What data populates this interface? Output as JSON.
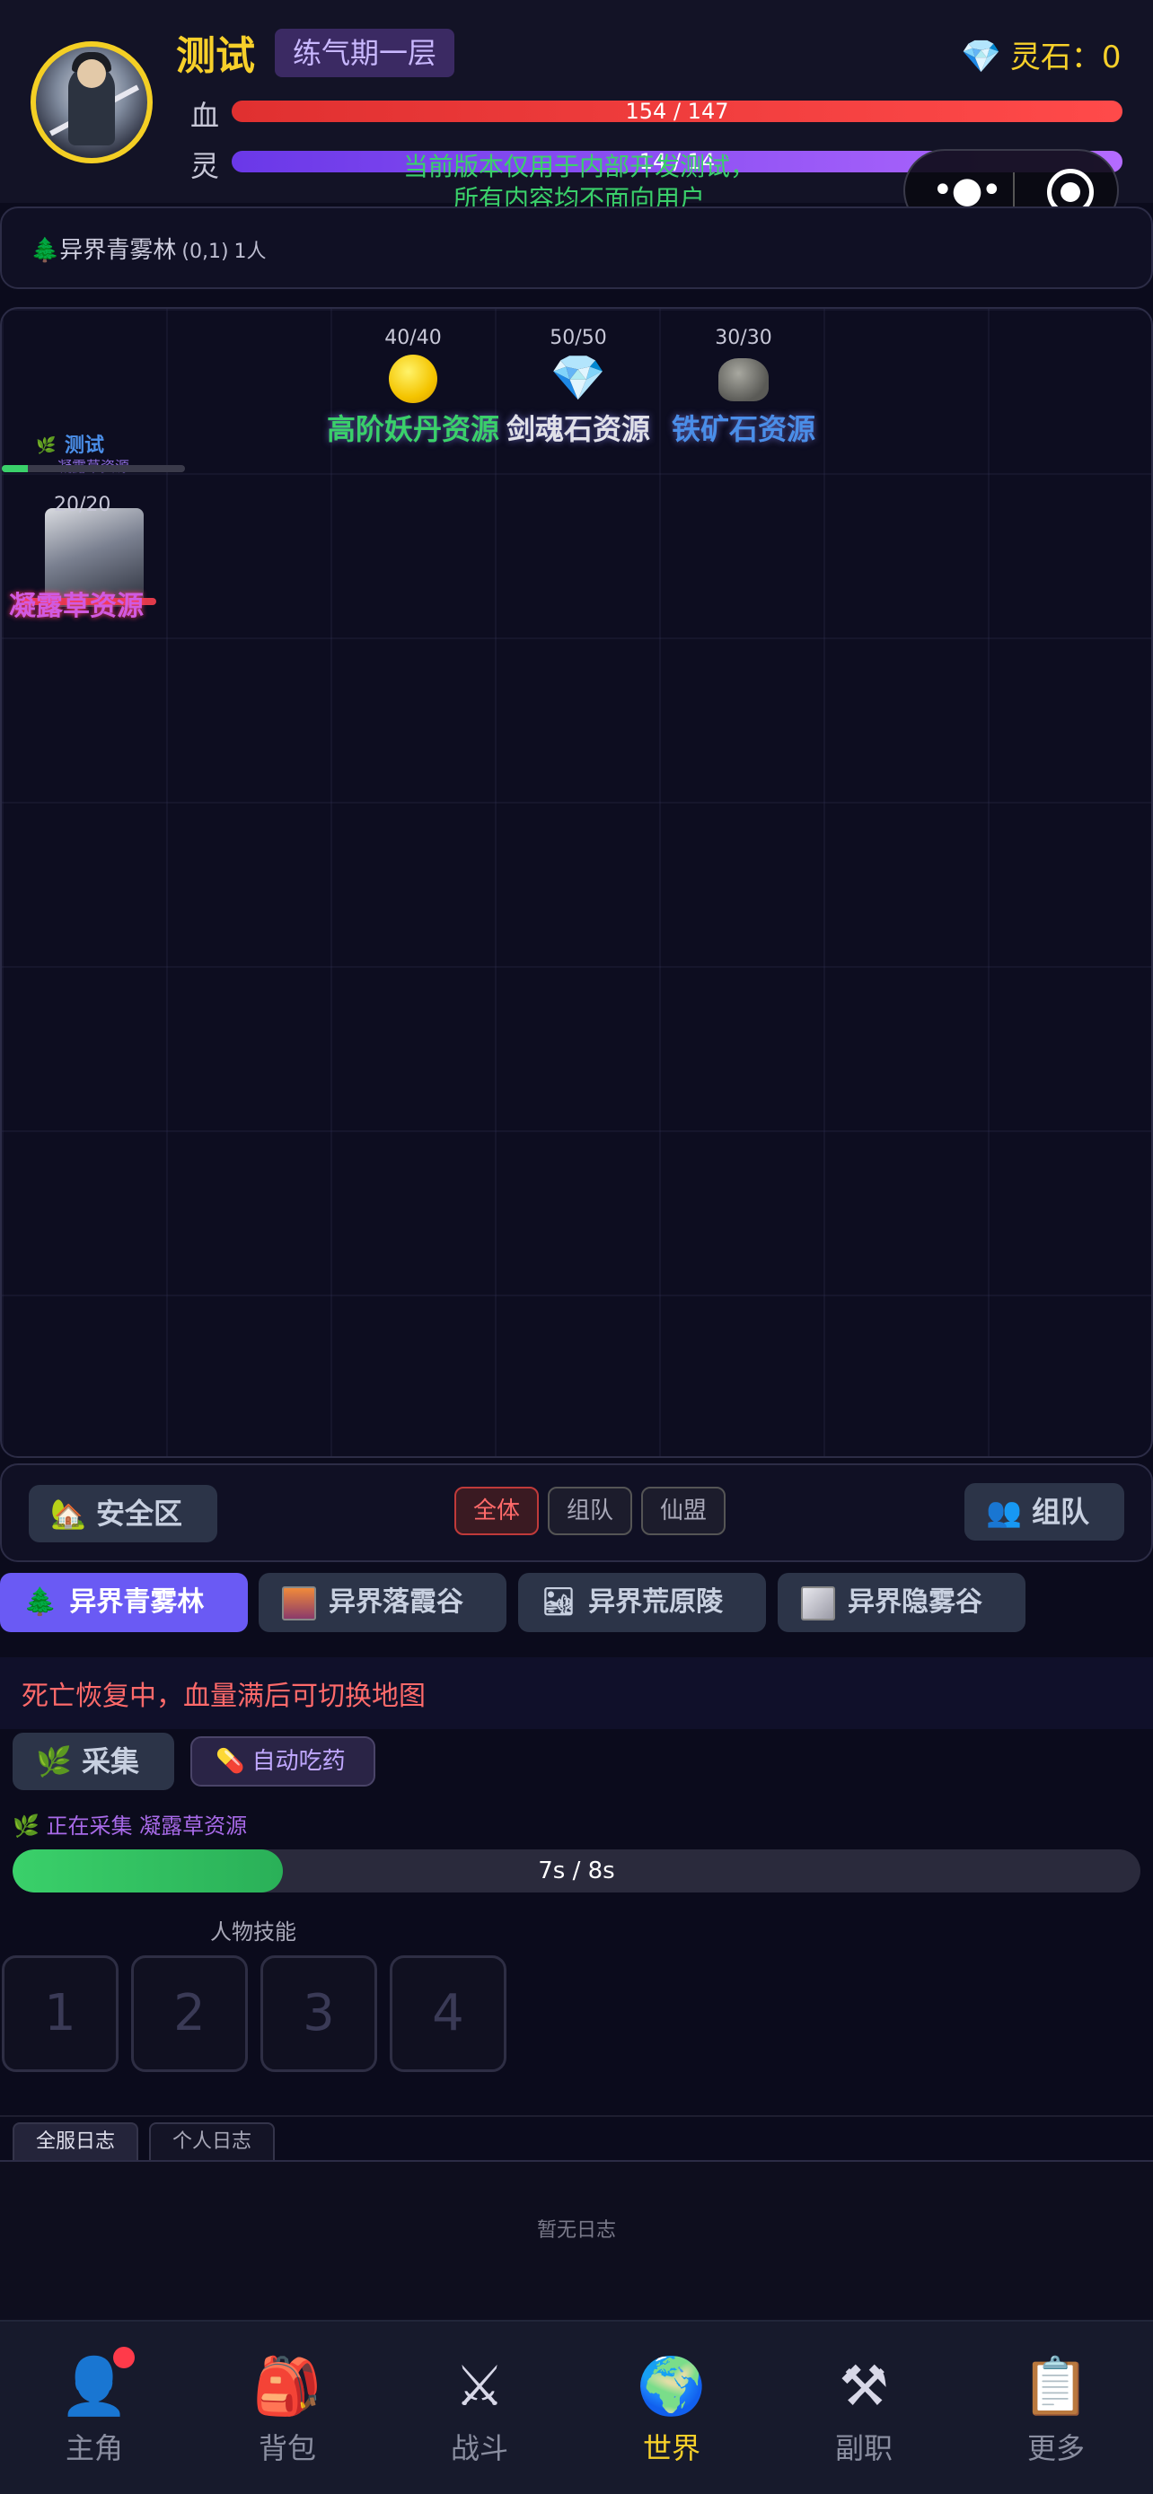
{
  "header": {
    "player_name": "测试",
    "realm": "练气期一层",
    "stone_label": "灵石：0",
    "stone_icon": "gem-icon",
    "hp_label": "血",
    "hp_text": "154 / 147",
    "hp_fraction": 1.0,
    "mp_label": "灵",
    "mp_text": "14 / 14",
    "mp_fraction": 1.0,
    "notice_line1": "当前版本仅用于内部开发测试，",
    "notice_line2": "所有内容均不面向用户"
  },
  "location": {
    "name": "异界青雾林",
    "coords": "(0,1)",
    "people": "1人"
  },
  "map": {
    "resources": [
      {
        "count": "40/40",
        "name": "高阶妖丹资源",
        "icon": "golden-orb-icon",
        "color": "#3ad06a"
      },
      {
        "count": "50/50",
        "name": "剑魂石资源",
        "icon": "gem-icon",
        "color": "#e0e0e8"
      },
      {
        "count": "30/30",
        "name": "铁矿石资源",
        "icon": "rock-icon",
        "color": "#4a8ee8"
      }
    ],
    "player_marker": {
      "name": "测试",
      "status": "凝露草资源",
      "progress": 0.14
    },
    "herb_spot": {
      "count": "20/20",
      "name": "凝露草资源"
    }
  },
  "controls": {
    "safe_zone": "安全区",
    "channels": [
      "全体",
      "组队",
      "仙盟"
    ],
    "team": "组队"
  },
  "map_tabs": [
    "异界青雾林",
    "异界落霞谷",
    "异界荒原陵",
    "异界隐雾谷"
  ],
  "status": {
    "death_message": "死亡恢复中，血量满后可切换地图",
    "gather_button": "采集",
    "auto_pill_button": "自动吃药",
    "gathering_text": "正在采集 凝露草资源",
    "progress_text": "7s / 8s",
    "progress_fraction": 0.24
  },
  "skills": {
    "title": "人物技能",
    "slots": [
      "1",
      "2",
      "3",
      "4"
    ]
  },
  "logs": {
    "tabs": [
      "全服日志",
      "个人日志"
    ],
    "empty_text": "暂无日志"
  },
  "bottom_nav": [
    {
      "label": "主角",
      "icon": "person-icon"
    },
    {
      "label": "背包",
      "icon": "backpack-icon"
    },
    {
      "label": "战斗",
      "icon": "crossed-swords-icon"
    },
    {
      "label": "世界",
      "icon": "globe-icon",
      "active": true
    },
    {
      "label": "副职",
      "icon": "pickaxe-icon"
    },
    {
      "label": "更多",
      "icon": "clipboard-icon"
    }
  ],
  "colors": {
    "accent_gold": "#f7d02a",
    "hp_red": "#e03030",
    "mp_purple": "#8a4af0",
    "active_tab": "#6a5af4",
    "progress_green": "#3ad06a"
  }
}
